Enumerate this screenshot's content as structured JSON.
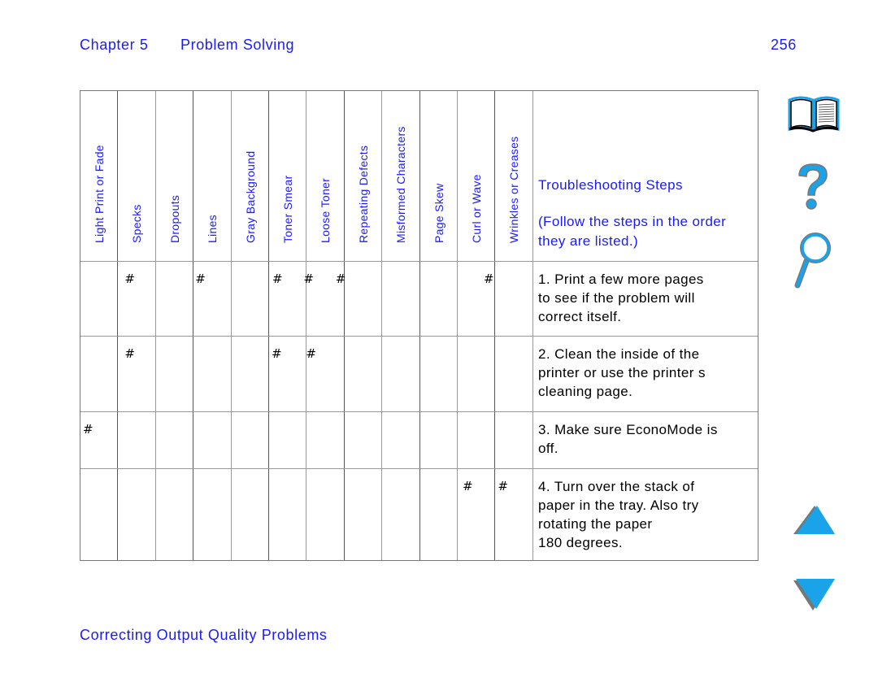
{
  "header": {
    "chapter": "Chapter 5",
    "chapter_title": "Problem Solving",
    "page_number": "256"
  },
  "table": {
    "columns": [
      "Light Print or Fade",
      "Specks",
      "Dropouts",
      "Lines",
      "Gray Background",
      "Toner Smear",
      "Loose Toner",
      "Repeating Defects",
      "Misformed Characters",
      "Page Skew",
      "Curl or Wave",
      "Wrinkles or Creases"
    ],
    "steps_heading": "Troubleshooting Steps",
    "steps_subheading": "(Follow the steps in the order they are listed.)",
    "mark_symbol": "#",
    "rows": [
      {
        "step": "1. Print a few more pages\nto see if the problem will\ncorrect itself.",
        "marked": [
          "Specks",
          "Lines",
          "Toner Smear",
          "Loose Toner",
          "Repeating Defects",
          "Curl or Wave"
        ]
      },
      {
        "step": "2. Clean the inside of the\nprinter or use the printer s\ncleaning page.",
        "marked": [
          "Specks",
          "Toner Smear",
          "Loose Toner"
        ]
      },
      {
        "step": "3. Make sure EconoMode is\noff.",
        "marked": [
          "Light Print or Fade"
        ]
      },
      {
        "step": "4. Turn over the stack of\npaper in the tray. Also try\nrotating the paper\n180 degrees.",
        "marked": [
          "Curl or Wave",
          "Wrinkles or Creases"
        ]
      }
    ]
  },
  "sidebar": {
    "icons": [
      "book-icon",
      "help-question-icon",
      "search-magnifier-icon"
    ],
    "nav": [
      "previous-page-arrow-icon",
      "next-page-arrow-icon"
    ],
    "accent_color": "#1aa3e8"
  },
  "footer": {
    "section_title": "Correcting Output Quality Problems"
  }
}
